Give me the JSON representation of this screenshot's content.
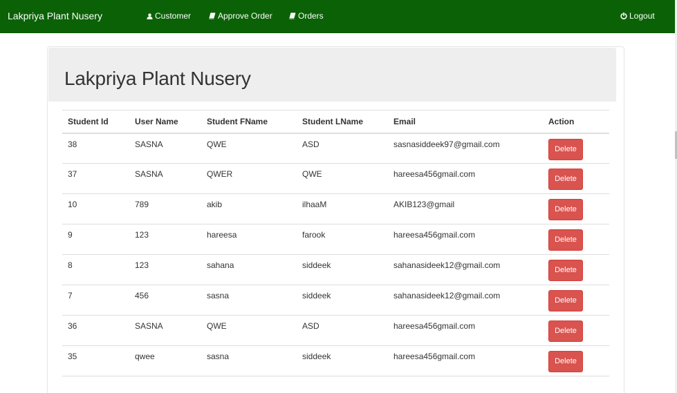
{
  "navbar": {
    "brand": "Lakpriya Plant Nusery",
    "links": [
      {
        "label": "Customer",
        "icon": "user-icon"
      },
      {
        "label": "Approve Order",
        "icon": "book-icon"
      },
      {
        "label": "Orders",
        "icon": "book-icon"
      }
    ],
    "logout": {
      "label": "Logout",
      "icon": "power-icon"
    },
    "background": "#0b6206"
  },
  "page": {
    "title": "Lakpriya Plant Nusery"
  },
  "table": {
    "headers": [
      "Student Id",
      "User Name",
      "Student FName",
      "Student LName",
      "Email",
      "Action"
    ],
    "rows": [
      [
        "38",
        "SASNA",
        "QWE",
        "ASD",
        "sasnasiddeek97@gmail.com",
        "Delete"
      ],
      [
        "37",
        "SASNA",
        "QWER",
        "QWE",
        "hareesa456gmail.com",
        "Delete"
      ],
      [
        "10",
        "789",
        "akib",
        "ilhaaM",
        "AKIB123@gmail",
        "Delete"
      ],
      [
        "9",
        "123",
        "hareesa",
        "farook",
        "hareesa456gmail.com",
        "Delete"
      ],
      [
        "8",
        "123",
        "sahana",
        "siddeek",
        "sahanasideek12@gmail.com",
        "Delete"
      ],
      [
        "7",
        "456",
        "sasna",
        "siddeek",
        "sahanasideek12@gmail.com",
        "Delete"
      ],
      [
        "36",
        "SASNA",
        "QWE",
        "ASD",
        "hareesa456gmail.com",
        "Delete"
      ],
      [
        "35",
        "qwee",
        "sasna",
        "siddeek",
        "hareesa456gmail.com",
        "Delete"
      ]
    ]
  },
  "colors": {
    "delete_button": "#d9534f",
    "jumbotron": "#eeeeee"
  }
}
